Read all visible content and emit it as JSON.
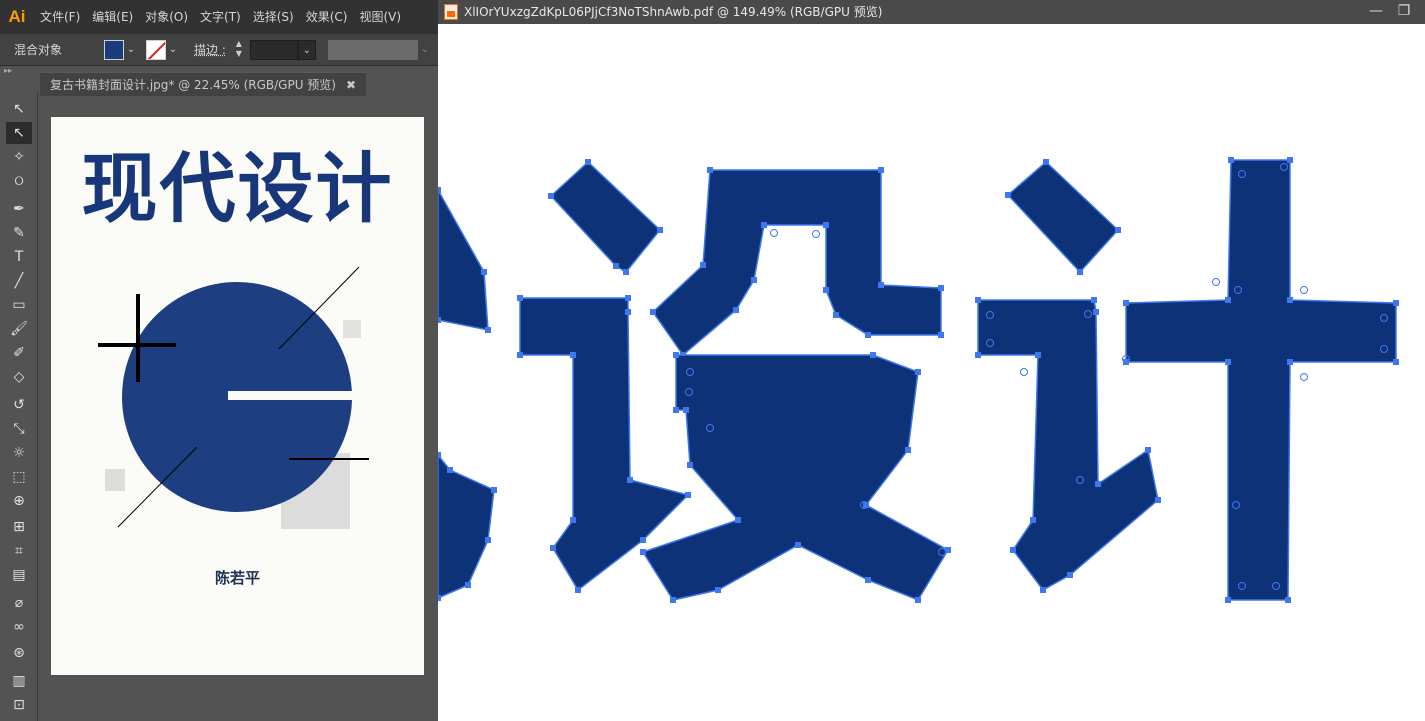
{
  "left_app": {
    "logo": "Ai",
    "menu": [
      "文件(F)",
      "编辑(E)",
      "对象(O)",
      "文字(T)",
      "选择(S)",
      "效果(C)",
      "视图(V)"
    ],
    "control_bar": {
      "selection_label": "混合对象",
      "stroke_label": "描边 :"
    },
    "collapse_glyph": "▸▸",
    "document_tab": {
      "title": "复古书籍封面设计.jpg* @ 22.45% (RGB/GPU 预览)",
      "close": "✖"
    },
    "tools": [
      {
        "name": "selection-tool",
        "glyph": "↖"
      },
      {
        "name": "direct-selection-tool",
        "glyph": "↖",
        "active": true
      },
      {
        "name": "magic-wand-tool",
        "glyph": "✧"
      },
      {
        "name": "lasso-tool",
        "glyph": "ଠ"
      },
      {
        "name": "pen-tool",
        "glyph": "✒"
      },
      {
        "name": "curvature-tool",
        "glyph": "✎"
      },
      {
        "name": "type-tool",
        "glyph": "T"
      },
      {
        "name": "line-tool",
        "glyph": "╱"
      },
      {
        "name": "rectangle-tool",
        "glyph": "▭"
      },
      {
        "name": "paintbrush-tool",
        "glyph": "🖌"
      },
      {
        "name": "shaper-tool",
        "glyph": "✐"
      },
      {
        "name": "eraser-tool",
        "glyph": "◇"
      },
      {
        "name": "rotate-tool",
        "glyph": "↺"
      },
      {
        "name": "scale-tool",
        "glyph": "⤡"
      },
      {
        "name": "warp-tool",
        "glyph": "☼"
      },
      {
        "name": "free-transform-tool",
        "glyph": "⬚"
      },
      {
        "name": "shape-builder-tool",
        "glyph": "⊕"
      },
      {
        "name": "perspective-grid-tool",
        "glyph": "⊞"
      },
      {
        "name": "mesh-tool",
        "glyph": "⌗"
      },
      {
        "name": "gradient-tool",
        "glyph": "▤"
      },
      {
        "name": "eyedropper-tool",
        "glyph": "⌀"
      },
      {
        "name": "blend-tool",
        "glyph": "∞"
      },
      {
        "name": "symbol-sprayer-tool",
        "glyph": "⊛"
      },
      {
        "name": "column-graph-tool",
        "glyph": "▥"
      },
      {
        "name": "artboard-tool",
        "glyph": "⊡"
      }
    ],
    "cover": {
      "title": "现代设计",
      "author": "陈若平",
      "accent": "#17377a"
    }
  },
  "right_app": {
    "title": "XlIOrYUxzgZdKpL06PJjCf3NoTShnAwb.pdf @ 149.49% (RGB/GPU 预览)",
    "minimize": "—",
    "restore": "❐"
  },
  "colors": {
    "glyph_fill": "#0e3278",
    "anchor_stroke": "#3f78ee"
  }
}
